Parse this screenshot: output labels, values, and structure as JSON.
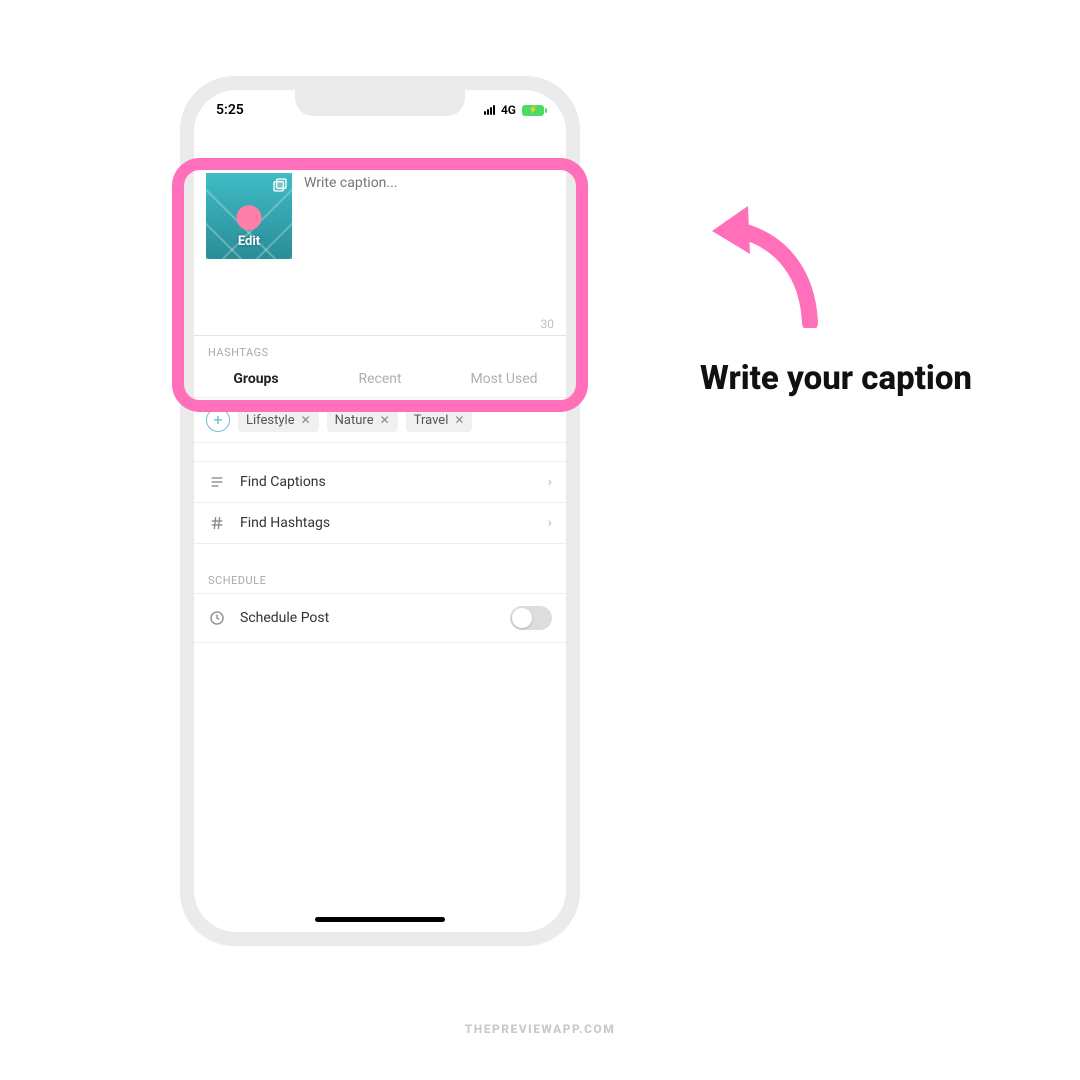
{
  "status": {
    "time": "5:25",
    "network": "4G"
  },
  "caption": {
    "placeholder": "Write caption...",
    "edit_label": "Edit",
    "char_count": "30"
  },
  "hashtags": {
    "section_label": "HASHTAGS",
    "tabs": {
      "groups": "Groups",
      "recent": "Recent",
      "most_used": "Most Used"
    },
    "chips": [
      "Lifestyle",
      "Nature",
      "Travel"
    ]
  },
  "rows": {
    "find_captions": "Find Captions",
    "find_hashtags": "Find Hashtags"
  },
  "schedule": {
    "section_label": "SCHEDULE",
    "label": "Schedule Post"
  },
  "annotation": {
    "text": "Write your caption"
  },
  "footer": "THEPREVIEWAPP.COM"
}
